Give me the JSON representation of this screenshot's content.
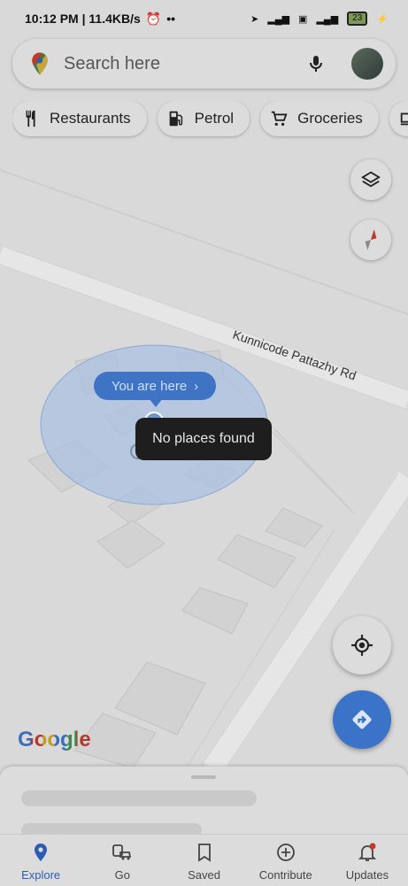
{
  "status_bar": {
    "time_speed": "10:12 PM | 11.4KB/s",
    "battery": "23"
  },
  "search": {
    "placeholder": "Search here"
  },
  "chips": [
    {
      "label": "Restaurants"
    },
    {
      "label": "Petrol"
    },
    {
      "label": "Groceries"
    }
  ],
  "map": {
    "road_label": "Kunnicode Pattazhy Rd",
    "you_are_here": "You are here",
    "you_are_here_chevron": "›",
    "toast": "No places found",
    "logo": "Google"
  },
  "bottom_nav": [
    {
      "label": "Explore"
    },
    {
      "label": "Go"
    },
    {
      "label": "Saved"
    },
    {
      "label": "Contribute"
    },
    {
      "label": "Updates"
    }
  ],
  "colors": {
    "accent": "#3a73c8",
    "active_nav": "#2b5eb3",
    "toast_bg": "#1e1e1e"
  }
}
